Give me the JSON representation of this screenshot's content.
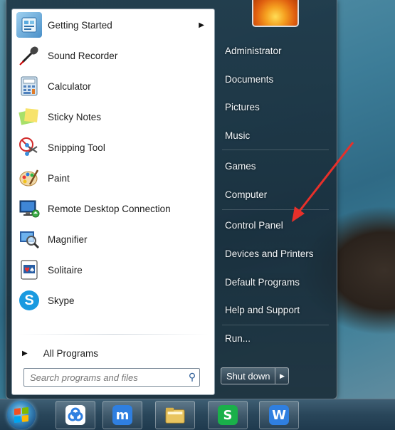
{
  "start_menu": {
    "programs": [
      {
        "label": "Getting Started",
        "icon": "getting-started-icon",
        "has_submenu": true
      },
      {
        "label": "Sound Recorder",
        "icon": "microphone-icon"
      },
      {
        "label": "Calculator",
        "icon": "calculator-icon"
      },
      {
        "label": "Sticky Notes",
        "icon": "sticky-notes-icon"
      },
      {
        "label": "Snipping Tool",
        "icon": "scissors-icon"
      },
      {
        "label": "Paint",
        "icon": "palette-icon"
      },
      {
        "label": "Remote Desktop Connection",
        "icon": "remote-desktop-icon"
      },
      {
        "label": "Magnifier",
        "icon": "magnifier-icon"
      },
      {
        "label": "Solitaire",
        "icon": "solitaire-icon"
      },
      {
        "label": "Skype",
        "icon": "skype-icon"
      }
    ],
    "all_programs_label": "All Programs",
    "search_placeholder": "Search programs and files",
    "right_items": [
      "Administrator",
      "Documents",
      "Pictures",
      "Music",
      "Games",
      "Computer",
      "Control Panel",
      "Devices and Printers",
      "Default Programs",
      "Help and Support",
      "Run..."
    ],
    "shutdown_label": "Shut down"
  },
  "taskbar": {
    "apps": [
      "start-orb-icon",
      "baidu-netdisk-icon",
      "maxthon-browser-icon",
      "file-explorer-icon",
      "wps-spreadsheet-icon",
      "wps-writer-icon"
    ]
  },
  "colors": {
    "annotation": "#e8302a",
    "skype": "#1a9ae0",
    "wps_green": "#1ab04a",
    "wps_blue": "#2f7fe0"
  }
}
